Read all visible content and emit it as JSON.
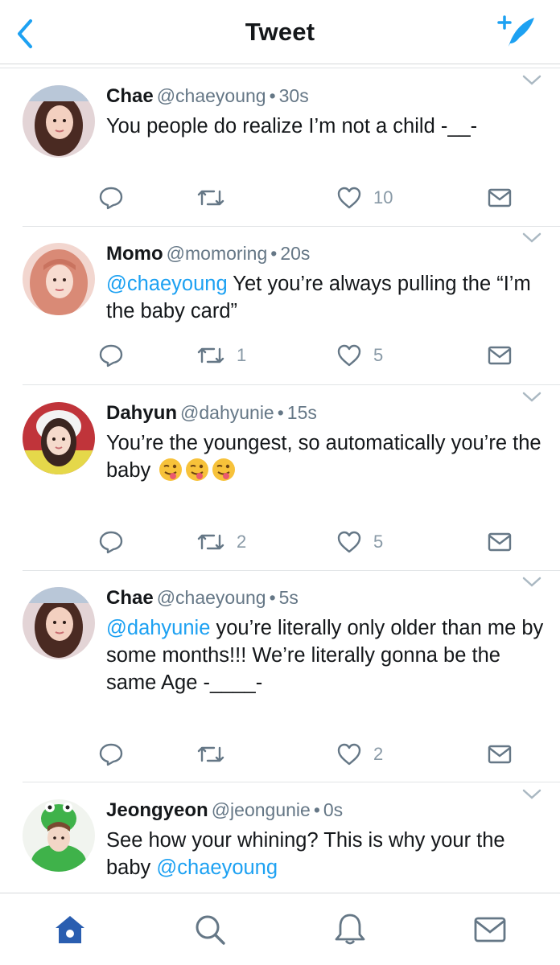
{
  "header": {
    "title": "Tweet",
    "back_icon": "chevron-left-icon",
    "compose_icon": "compose-tweet-icon",
    "accent_color": "#1da1f2"
  },
  "tweets": [
    {
      "name": "Chae",
      "handle": "@chaeyoung",
      "time": "30s",
      "mention": "",
      "text": "You people do realize I’m not a child -__-",
      "retweets": "",
      "likes": "10"
    },
    {
      "name": "Momo",
      "handle": "@momoring",
      "time": "20s",
      "mention": "@chaeyoung",
      "text": " Yet you’re always pulling the “I’m the baby card”",
      "retweets": "1",
      "likes": "5"
    },
    {
      "name": "Dahyun",
      "handle": "@dahyunie",
      "time": "15s",
      "mention": "",
      "text": "You’re the youngest, so automatically you’re the baby",
      "emoji_names": [
        "winking-tongue-emoji",
        "winking-tongue-emoji",
        "winking-tongue-emoji"
      ],
      "retweets": "2",
      "likes": "5"
    },
    {
      "name": "Chae",
      "handle": "@chaeyoung",
      "time": "5s",
      "mention": "@dahyunie",
      "text": " you’re literally only older than me by some months!!! We’re literally gonna be the same Age -____-",
      "retweets": "",
      "likes": "2"
    },
    {
      "name": "Jeongyeon",
      "handle": "@jeongunie",
      "time": "0s",
      "text": "See how your whining? This is why your the baby ",
      "trailing_mention": "@chaeyoung"
    }
  ],
  "tabbar": {
    "items": [
      "home-icon",
      "search-icon",
      "notifications-bell-icon",
      "messages-envelope-icon"
    ],
    "active_color": "#2a5eb0",
    "inactive_color": "#657786"
  }
}
